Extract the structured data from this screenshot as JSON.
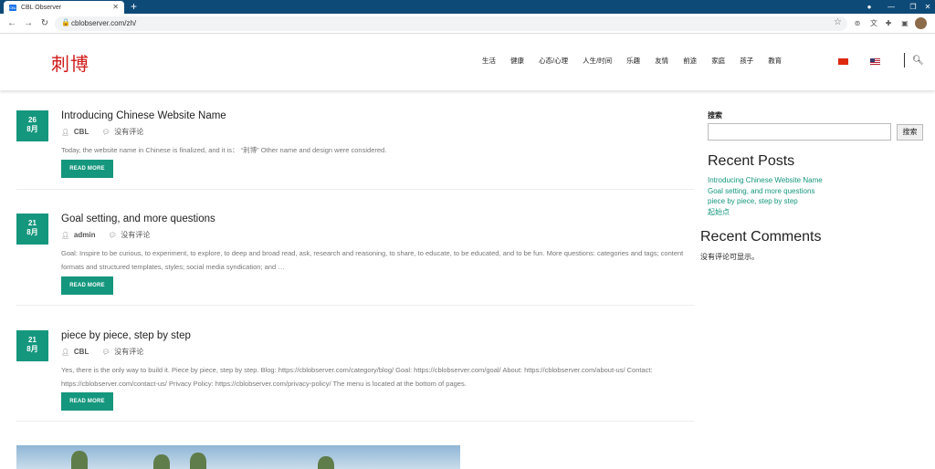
{
  "browser": {
    "tab_title": "CBL Observer",
    "tab_favicon": "CBL",
    "url": "cblobserver.com/zh/"
  },
  "site": {
    "logo_text": "刺博",
    "nav": [
      "生活",
      "健康",
      "心态/心理",
      "人生/时间",
      "乐趣",
      "友情",
      "前途",
      "家庭",
      "孩子",
      "教育"
    ]
  },
  "posts": [
    {
      "day": "26",
      "month": "8月",
      "title": "Introducing Chinese Website Name",
      "author": "CBL",
      "comments": "没有评论",
      "excerpt": "Today, the website name in Chinese is finalized, and it is： “刺博” Other name and design were considered.",
      "read_more": "READ MORE"
    },
    {
      "day": "21",
      "month": "8月",
      "title": "Goal setting, and more questions",
      "author": "admin",
      "comments": "没有评论",
      "excerpt": "Goal: Inspire to be curious, to experiment, to explore, to deep and broad read, ask, research and reasoning, to share, to educate, to be educated, and to be fun. More questions: categories and tags; content formats and structured templates, styles; social media syndication; and …",
      "read_more": "READ MORE"
    },
    {
      "day": "21",
      "month": "8月",
      "title": "piece by piece, step by step",
      "author": "CBL",
      "comments": "没有评论",
      "excerpt": "Yes, there is the only way to build it. Piece by piece, step by step. Blog: https://cblobserver.com/category/blog/ Goal: https://cblobserver.com/goal/ About: https://cblobserver.com/about-us/ Contact: https://cblobserver.com/contact-us/ Privacy Policy: https://cblobserver.com/privacy-policy/ The menu is located at the bottom of pages.",
      "read_more": "READ MORE"
    }
  ],
  "sidebar": {
    "search_label": "搜索",
    "search_button": "搜索",
    "recent_posts_heading": "Recent Posts",
    "recent_posts": [
      "Introducing Chinese Website Name",
      "Goal setting, and more questions",
      "piece by piece, step by step",
      "起始点"
    ],
    "recent_comments_heading": "Recent Comments",
    "no_comments": "没有评论可显示。"
  },
  "colors": {
    "accent": "#15977e",
    "logo": "#d11a1a",
    "tabbar": "#0e4a78"
  }
}
